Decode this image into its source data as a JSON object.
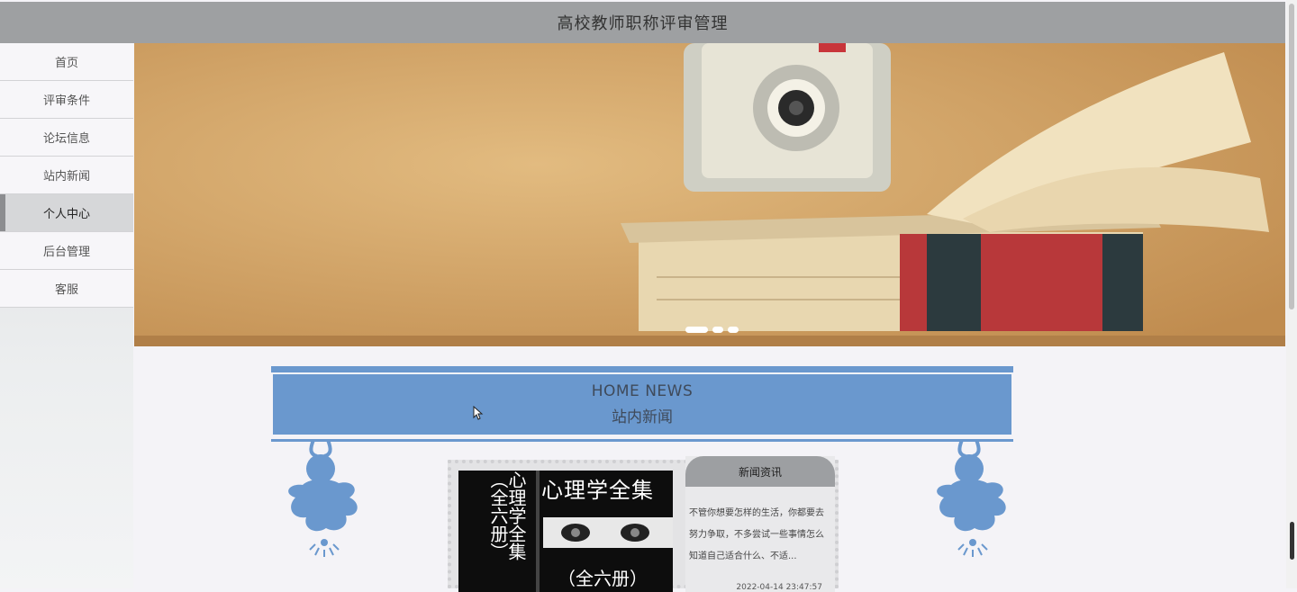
{
  "header": {
    "title": "高校教师职称评审管理"
  },
  "sidebar": {
    "items": [
      {
        "label": "首页",
        "active": false
      },
      {
        "label": "评审条件",
        "active": false
      },
      {
        "label": "论坛信息",
        "active": false
      },
      {
        "label": "站内新闻",
        "active": false
      },
      {
        "label": "个人中心",
        "active": true
      },
      {
        "label": "后台管理",
        "active": false
      },
      {
        "label": "客服",
        "active": false
      }
    ]
  },
  "banner": {
    "slide_count": 3,
    "active_slide": 1
  },
  "news": {
    "title_en": "HOME NEWS",
    "title_cn": "站内新闻",
    "card": {
      "image_text_vertical": "心理学全集（全六册）",
      "image_title": "心理学全集",
      "image_subtitle": "（全六册）",
      "side_title": "新闻资讯",
      "summary": "不管你想要怎样的生活，你都要去努力争取，不多尝试一些事情怎么知道自己适合什么、不适...",
      "date": "2022-04-14 23:47:57"
    }
  },
  "colors": {
    "header": "#9ea0a2",
    "accent_blue": "#6a98ce",
    "active_nav": "#d6d7d9"
  }
}
